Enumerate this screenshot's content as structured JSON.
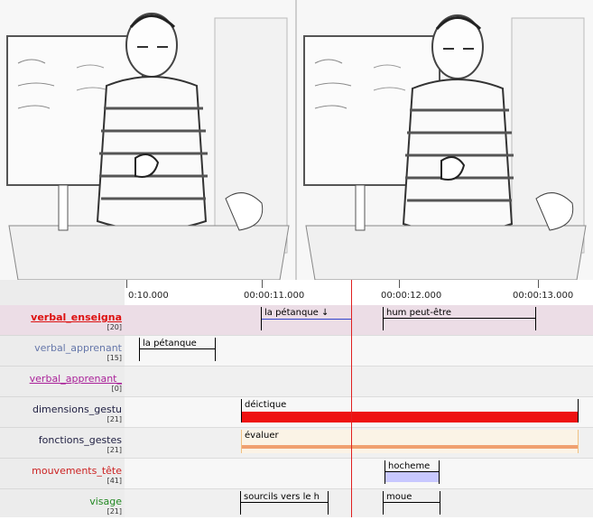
{
  "colors": {
    "cursor": "#e02020",
    "selected_tier_bg": "#ecdde6",
    "selected_annotation_line": "#3344cc",
    "dimensions_bar": "#ee1111",
    "fonctions_bar": "#f0a070",
    "mouvements_fill": "#c8c8ff"
  },
  "ruler": {
    "ticks": [
      "0:10.000",
      "00:00:11.000",
      "00:00:12.000",
      "00:00:13.000"
    ]
  },
  "tiers": [
    {
      "name": "verbal_enseigna",
      "count": "[20]",
      "color": "#dd1111",
      "bold": true
    },
    {
      "name": "verbal_apprenant",
      "count": "[15]",
      "color": "#6677aa",
      "bold": false
    },
    {
      "name": "verbal_apprenant_",
      "count": "[0]",
      "color": "#aa2299",
      "bold": false
    },
    {
      "name": "dimensions_gestu",
      "count": "[21]",
      "color": "#222244",
      "bold": false
    },
    {
      "name": "fonctions_gestes",
      "count": "[21]",
      "color": "#222244",
      "bold": false
    },
    {
      "name": "mouvements_tête",
      "count": "[41]",
      "color": "#cc2222",
      "bold": false
    },
    {
      "name": "visage",
      "count": "[21]",
      "color": "#228822",
      "bold": false
    }
  ],
  "annotations": {
    "verbal_enseigna": [
      "la pétanque ↓",
      "hum peut-être"
    ],
    "verbal_apprenant": [
      "la pétanque"
    ],
    "dimensions_gestu": [
      "déictique"
    ],
    "fonctions_gestes": [
      "évaluer"
    ],
    "mouvements_tete": [
      "hocheme"
    ],
    "visage": [
      "sourcils vers le h",
      "moue"
    ]
  }
}
